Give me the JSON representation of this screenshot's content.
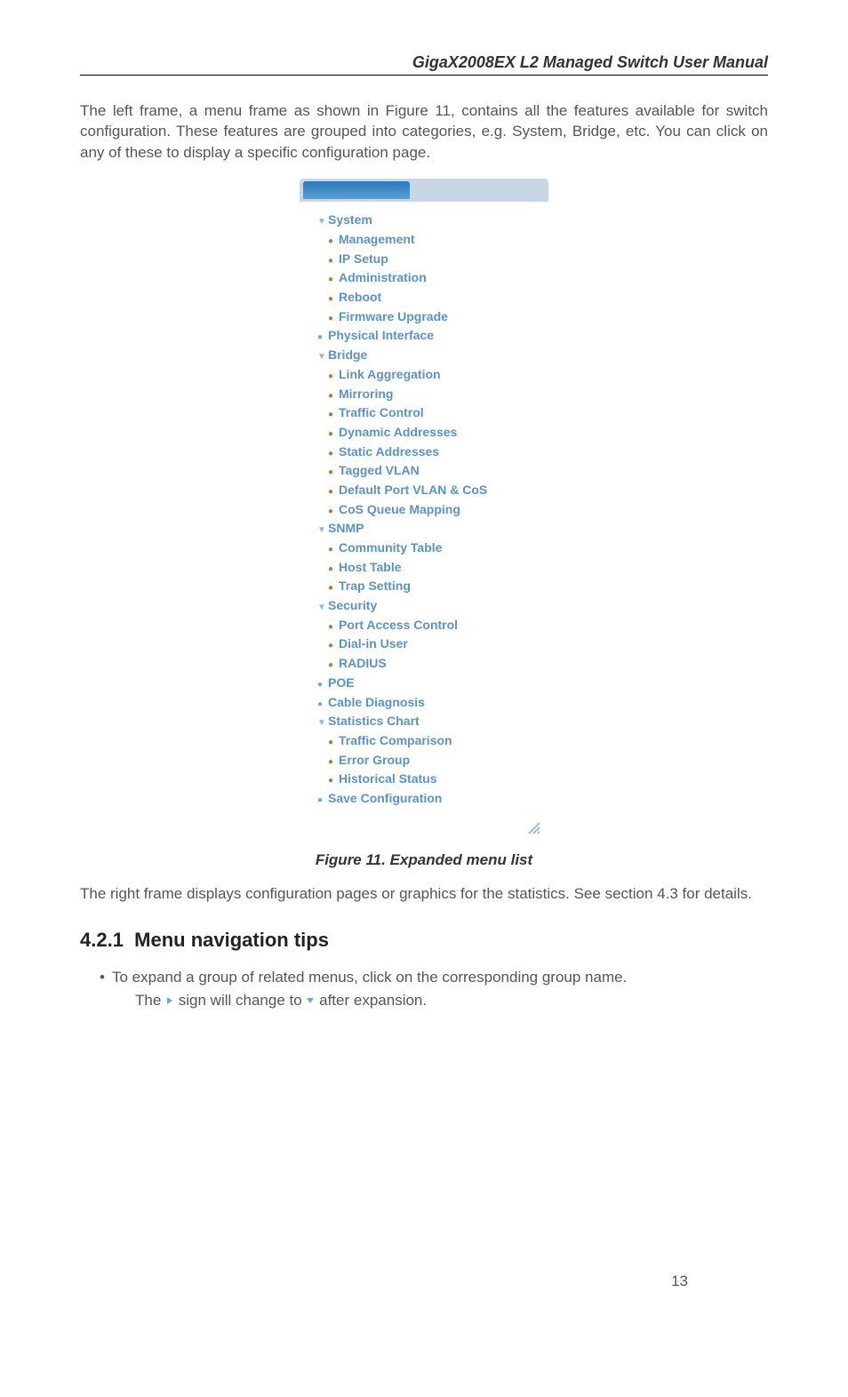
{
  "header": {
    "title": "GigaX2008EX L2 Managed Switch User Manual"
  },
  "intro": "The left frame, a menu frame as shown in Figure 11, contains all the features available for switch configuration. These features are grouped into categories, e.g. System, Bridge, etc. You can click on any of these to display a specific configuration page.",
  "menu": {
    "groups": [
      {
        "type": "group",
        "label": "System",
        "items": [
          "Management",
          "IP Setup",
          "Administration",
          "Reboot",
          "Firmware Upgrade"
        ]
      },
      {
        "type": "leaf",
        "label": "Physical Interface"
      },
      {
        "type": "group",
        "label": "Bridge",
        "items": [
          "Link Aggregation",
          "Mirroring",
          "Traffic Control",
          "Dynamic Addresses",
          "Static Addresses",
          "Tagged VLAN",
          "Default Port VLAN & CoS",
          "CoS Queue Mapping"
        ]
      },
      {
        "type": "group",
        "label": "SNMP",
        "items": [
          "Community Table",
          "Host Table",
          "Trap Setting"
        ]
      },
      {
        "type": "group",
        "label": "Security",
        "items": [
          "Port Access Control",
          "Dial-in User",
          "RADIUS"
        ]
      },
      {
        "type": "leaf",
        "label": "POE"
      },
      {
        "type": "leaf",
        "label": "Cable Diagnosis"
      },
      {
        "type": "group",
        "label": "Statistics Chart",
        "items": [
          "Traffic Comparison",
          "Error Group",
          "Historical Status"
        ]
      },
      {
        "type": "leaf",
        "label": "Save Configuration"
      }
    ]
  },
  "caption": "Figure 11. Expanded menu list",
  "after": "The right frame displays configuration pages or graphics for the statistics. See section 4.3 for details.",
  "section": {
    "number": "4.2.1",
    "title": "Menu navigation tips"
  },
  "tips": {
    "line1": "To expand a group of related menus, click on the corresponding group name.",
    "line2a": "The ",
    "line2b": " sign will change to ",
    "line2c": " after expansion."
  },
  "page_number": "13"
}
